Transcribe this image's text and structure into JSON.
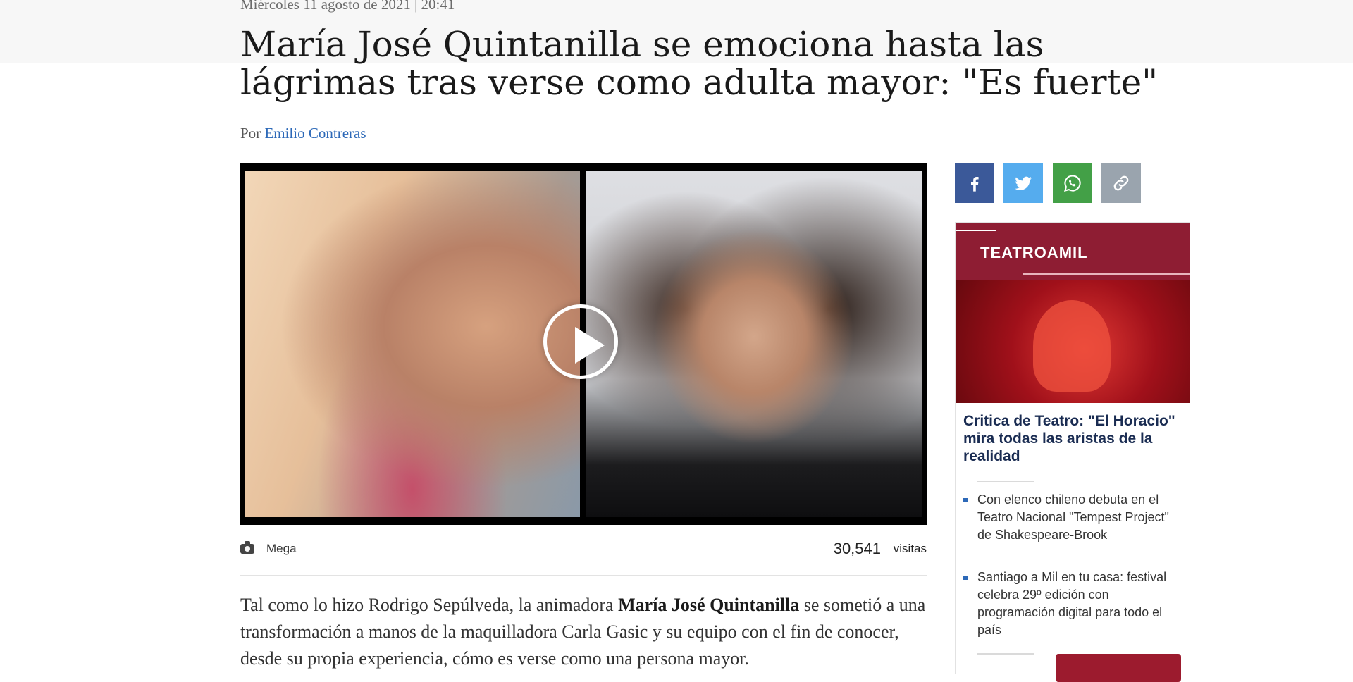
{
  "article": {
    "date": "Miércoles 11 agosto de 2021 | 20:41",
    "headline": "María José Quintanilla se emociona hasta las lágrimas tras verse como adulta mayor: \"Es fuerte\"",
    "byline_prefix": "Por",
    "author": "Emilio Contreras"
  },
  "media": {
    "credit": "Mega",
    "views": "30,541",
    "views_label": "visitas",
    "icons": {
      "camera": "camera-icon",
      "play": "play-icon"
    }
  },
  "body": {
    "p1_start": "Tal como lo hizo Rodrigo Sepúlveda, la animadora ",
    "p1_bold": "María José Quintanilla",
    "p1_end": " se sometió a una transformación a manos de la maquilladora Carla Gasic y su equipo con el fin de conocer, desde su propia experiencia, cómo es verse como una persona mayor."
  },
  "share": {
    "icons": [
      "facebook-icon",
      "twitter-icon",
      "whatsapp-icon",
      "link-icon"
    ],
    "colors": {
      "facebook": "#3b5999",
      "twitter": "#55acee",
      "whatsapp": "#43a047",
      "link": "#9aa4ae"
    }
  },
  "sidebar": {
    "brand": "TEATROAMIL",
    "headline": "Critica de Teatro: \"El Horacio\" mira todas las aristas de la realidad",
    "items": [
      {
        "label": "Con elenco chileno debuta en el Teatro Nacional \"Tempest Project\" de Shakespeare-Brook"
      },
      {
        "label": "Santiago a Mil en tu casa: festival celebra 29º edición con programación digital para todo el país"
      }
    ],
    "accent_color": "#9c1b2e"
  }
}
